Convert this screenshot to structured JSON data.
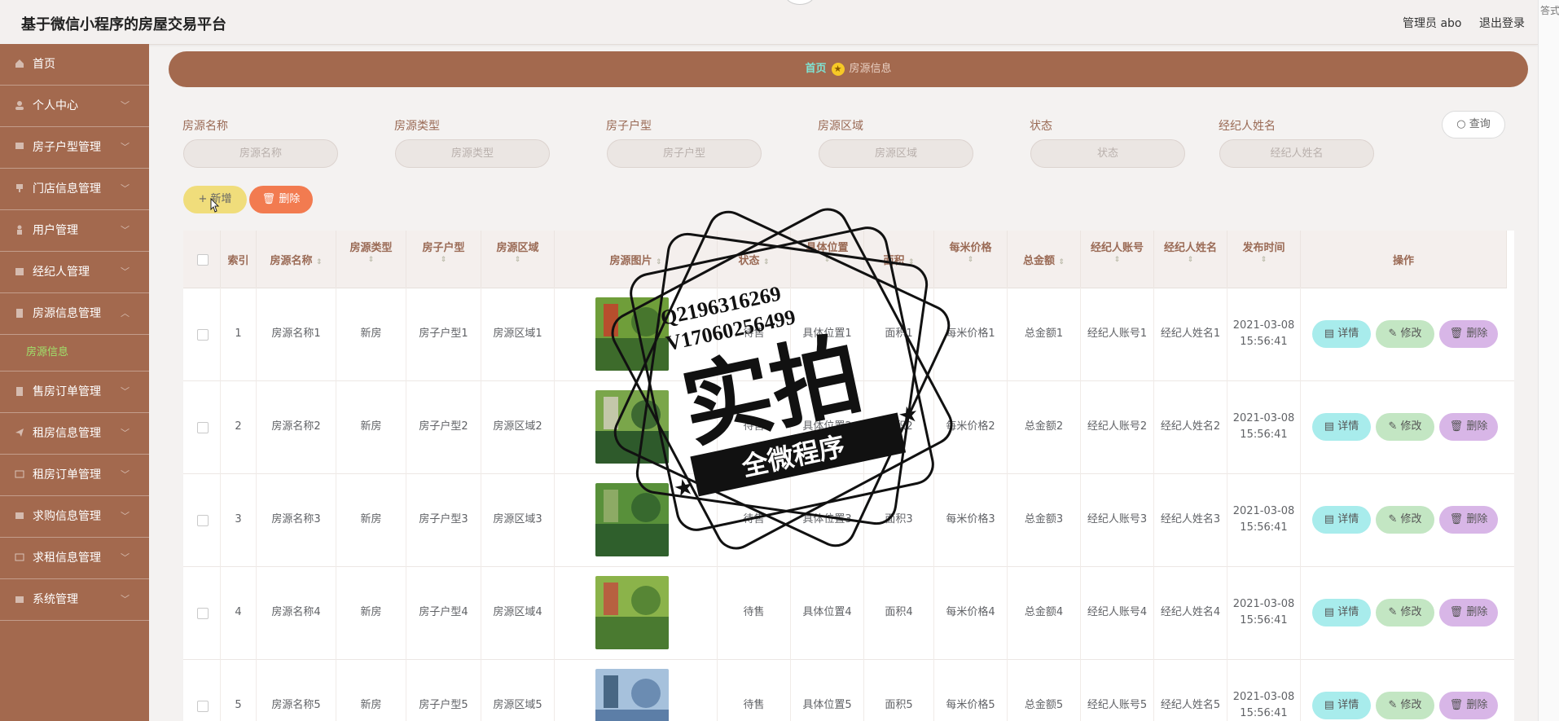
{
  "header": {
    "app_title": "基于微信小程序的房屋交易平台",
    "admin_label": "管理员 abo",
    "logout_label": "退出登录",
    "edge_text": "答式"
  },
  "sidebar": {
    "items": [
      {
        "label": "首页",
        "icon": "home-icon",
        "chevron": false
      },
      {
        "label": "个人中心",
        "icon": "user-icon",
        "chevron": true
      },
      {
        "label": "房子户型管理",
        "icon": "chat-icon",
        "chevron": true
      },
      {
        "label": "门店信息管理",
        "icon": "cup-icon",
        "chevron": true
      },
      {
        "label": "用户管理",
        "icon": "person-icon",
        "chevron": true
      },
      {
        "label": "经纪人管理",
        "icon": "briefcase-icon",
        "chevron": true
      },
      {
        "label": "房源信息管理",
        "icon": "building-icon",
        "chevron": true,
        "expanded": true
      },
      {
        "label": "售房订单管理",
        "icon": "document-icon",
        "chevron": true
      },
      {
        "label": "租房信息管理",
        "icon": "send-icon",
        "chevron": true
      },
      {
        "label": "租房订单管理",
        "icon": "mail-open-icon",
        "chevron": true
      },
      {
        "label": "求购信息管理",
        "icon": "envelope-icon",
        "chevron": true
      },
      {
        "label": "求租信息管理",
        "icon": "message-icon",
        "chevron": true
      },
      {
        "label": "系统管理",
        "icon": "toolbox-icon",
        "chevron": true
      }
    ],
    "sub_item": "房源信息"
  },
  "breadcrumb": {
    "home": "首页",
    "current": "房源信息"
  },
  "filters": [
    {
      "label": "房源名称",
      "placeholder": "房源名称"
    },
    {
      "label": "房源类型",
      "placeholder": "房源类型"
    },
    {
      "label": "房子户型",
      "placeholder": "房子户型"
    },
    {
      "label": "房源区域",
      "placeholder": "房源区域"
    },
    {
      "label": "状态",
      "placeholder": "状态"
    },
    {
      "label": "经纪人姓名",
      "placeholder": "经纪人姓名"
    }
  ],
  "query_label": "查询",
  "add_label": "新增",
  "delete_label": "删除",
  "table": {
    "headers": [
      "索引",
      "房源名称",
      "房源类型",
      "房子户型",
      "房源区域",
      "房源图片",
      "状态",
      "具体位置",
      "面积",
      "每米价格",
      "总金额",
      "经纪人账号",
      "经纪人姓名",
      "发布时间",
      "操作"
    ],
    "rows": [
      {
        "index": "1",
        "name": "房源名称1",
        "type": "新房",
        "layout": "房子户型1",
        "area_zone": "房源区域1",
        "status": "待售",
        "location": "具体位置1",
        "area": "面积1",
        "price": "每米价格1",
        "total": "总金额1",
        "account": "经纪人账号1",
        "agent": "经纪人姓名1",
        "date": "2021-03-08",
        "time": "15:56:41"
      },
      {
        "index": "2",
        "name": "房源名称2",
        "type": "新房",
        "layout": "房子户型2",
        "area_zone": "房源区域2",
        "status": "待售",
        "location": "具体位置2",
        "area": "面积2",
        "price": "每米价格2",
        "total": "总金额2",
        "account": "经纪人账号2",
        "agent": "经纪人姓名2",
        "date": "2021-03-08",
        "time": "15:56:41"
      },
      {
        "index": "3",
        "name": "房源名称3",
        "type": "新房",
        "layout": "房子户型3",
        "area_zone": "房源区域3",
        "status": "待售",
        "location": "具体位置3",
        "area": "面积3",
        "price": "每米价格3",
        "total": "总金额3",
        "account": "经纪人账号3",
        "agent": "经纪人姓名3",
        "date": "2021-03-08",
        "time": "15:56:41"
      },
      {
        "index": "4",
        "name": "房源名称4",
        "type": "新房",
        "layout": "房子户型4",
        "area_zone": "房源区域4",
        "status": "待售",
        "location": "具体位置4",
        "area": "面积4",
        "price": "每米价格4",
        "total": "总金额4",
        "account": "经纪人账号4",
        "agent": "经纪人姓名4",
        "date": "2021-03-08",
        "time": "15:56:41"
      },
      {
        "index": "5",
        "name": "房源名称5",
        "type": "新房",
        "layout": "房子户型5",
        "area_zone": "房源区域5",
        "status": "待售",
        "location": "具体位置5",
        "area": "面积5",
        "price": "每米价格5",
        "total": "总金额5",
        "account": "经纪人账号5",
        "agent": "经纪人姓名5",
        "date": "2021-03-08",
        "time": "15:56:41"
      }
    ],
    "actions": {
      "detail": "详情",
      "edit": "修改",
      "remove": "删除"
    }
  },
  "watermark": {
    "line1": "Q2196316269",
    "line2": "V17060256499",
    "big": "实拍",
    "banner": "全微程序"
  },
  "colors": {
    "sidebar": "#a3694e",
    "breadcrumb": "#a3694e",
    "active_sub": "#9fe26b",
    "add_button": "#f0dd7b",
    "delete_button": "#f27b50"
  }
}
